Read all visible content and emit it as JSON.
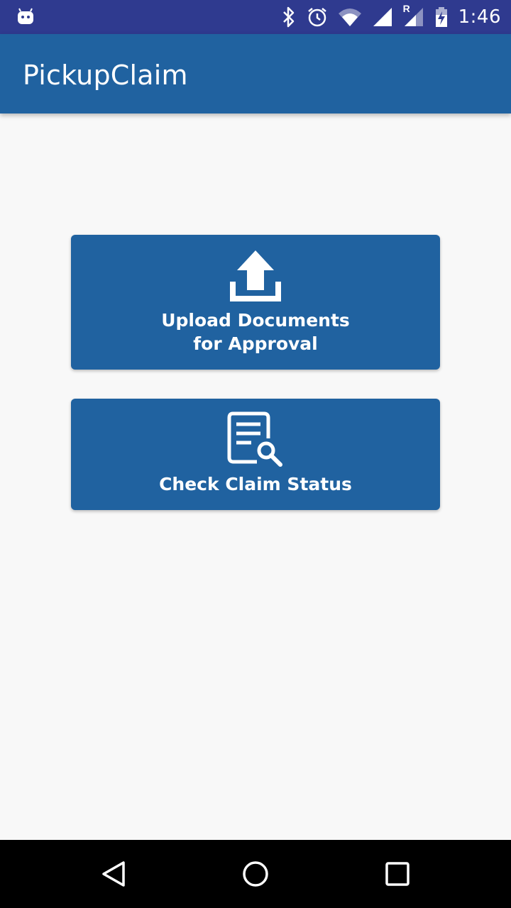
{
  "status_bar": {
    "time": "1:46",
    "icons": [
      "android-icon",
      "bluetooth-icon",
      "alarm-icon",
      "wifi-icon",
      "signal-icon",
      "roaming-signal-icon",
      "battery-charging-icon"
    ],
    "roaming_indicator": "R",
    "background_color": "#2f3a8f"
  },
  "app_bar": {
    "title": "PickupClaim",
    "background_color": "#2062a0"
  },
  "actions": {
    "upload": {
      "label_line1": "Upload Documents",
      "label_line2": "for Approval",
      "icon": "upload-icon"
    },
    "status": {
      "label": "Check Claim Status",
      "icon": "document-search-icon"
    },
    "card_color": "#2062a0"
  },
  "nav_bar": {
    "buttons": [
      "back-icon",
      "home-icon",
      "recents-icon"
    ]
  }
}
